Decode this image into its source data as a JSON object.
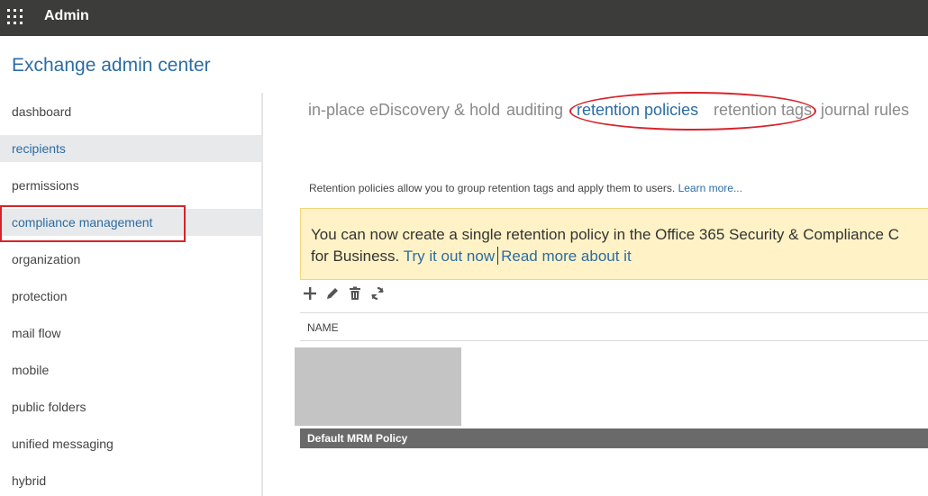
{
  "topbar": {
    "app_name": "Admin",
    "launcher_icon": "waffle-icon"
  },
  "eac": {
    "title": "Exchange admin center"
  },
  "sidebar": {
    "items": [
      {
        "label": "dashboard"
      },
      {
        "label": "recipients"
      },
      {
        "label": "permissions"
      },
      {
        "label": "compliance management"
      },
      {
        "label": "organization"
      },
      {
        "label": "protection"
      },
      {
        "label": "mail flow"
      },
      {
        "label": "mobile"
      },
      {
        "label": "public folders"
      },
      {
        "label": "unified messaging"
      },
      {
        "label": "hybrid"
      }
    ]
  },
  "tabs": [
    {
      "label": "in-place eDiscovery & hold"
    },
    {
      "label": "auditing"
    },
    {
      "label": "retention policies"
    },
    {
      "label": "retention tags"
    },
    {
      "label": "journal rules"
    }
  ],
  "description": {
    "text": "Retention policies allow you to group retention tags and apply them to users. ",
    "link": "Learn more..."
  },
  "banner": {
    "line1": "You can now create a single retention policy in the Office 365 Security & Compliance C",
    "line2_prefix": "for Business. ",
    "link1": "Try it out now",
    "link2": "Read more about it"
  },
  "toolbar": {
    "icons": [
      "add-icon",
      "edit-icon",
      "delete-icon",
      "refresh-icon"
    ]
  },
  "table": {
    "columns": [
      "NAME"
    ],
    "rows": [
      {
        "name": "Default MRM Policy"
      }
    ]
  },
  "colors": {
    "accent": "#2b6ca3",
    "annotation": "#d8232a",
    "topbar": "#3c3c3b",
    "banner": "#fff2c6"
  }
}
